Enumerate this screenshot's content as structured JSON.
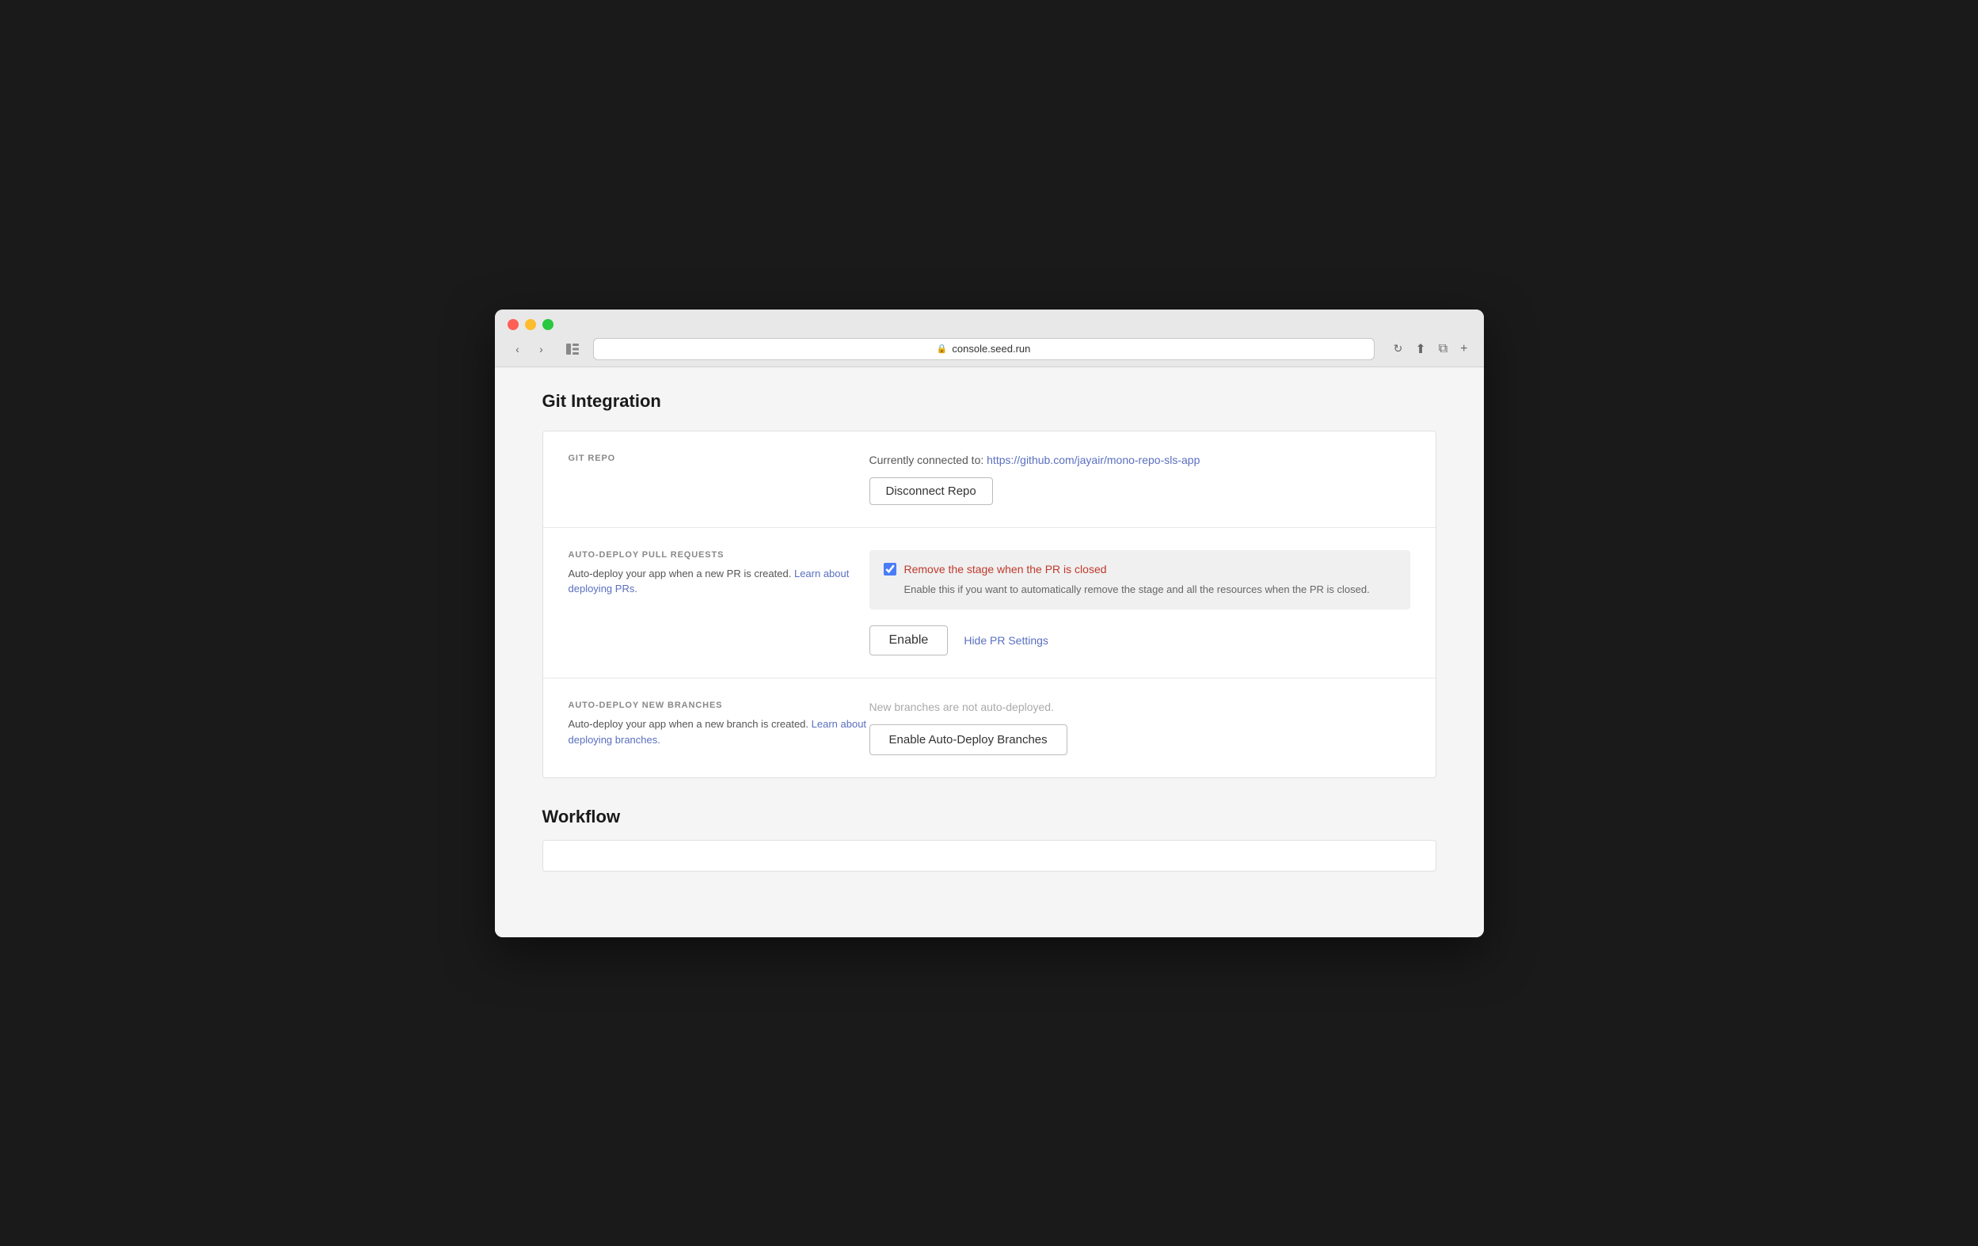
{
  "browser": {
    "url": "console.seed.run",
    "traffic_lights": [
      "red",
      "yellow",
      "green"
    ]
  },
  "page": {
    "title": "Git Integration",
    "workflow_title": "Workflow"
  },
  "git_repo_section": {
    "label": "GIT REPO",
    "connected_prefix": "Currently connected to:",
    "connected_url": "https://github.com/jayair/mono-repo-sls-app",
    "disconnect_button": "Disconnect Repo"
  },
  "auto_deploy_pr_section": {
    "label": "AUTO-DEPLOY PULL REQUESTS",
    "description": "Auto-deploy your app when a new PR is created.",
    "learn_link_text": "Learn about deploying PRs.",
    "checkbox_label": "Remove the stage when the PR is closed",
    "checkbox_checked": true,
    "checkbox_description": "Enable this if you want to automatically remove the stage and all the resources when the PR is closed.",
    "enable_button": "Enable",
    "hide_link": "Hide PR Settings"
  },
  "auto_deploy_branches_section": {
    "label": "AUTO-DEPLOY NEW BRANCHES",
    "description": "Auto-deploy your app when a new branch is created.",
    "learn_link_text": "Learn about deploying branches.",
    "status_text": "New branches are not auto-deployed.",
    "enable_button": "Enable Auto-Deploy Branches"
  }
}
